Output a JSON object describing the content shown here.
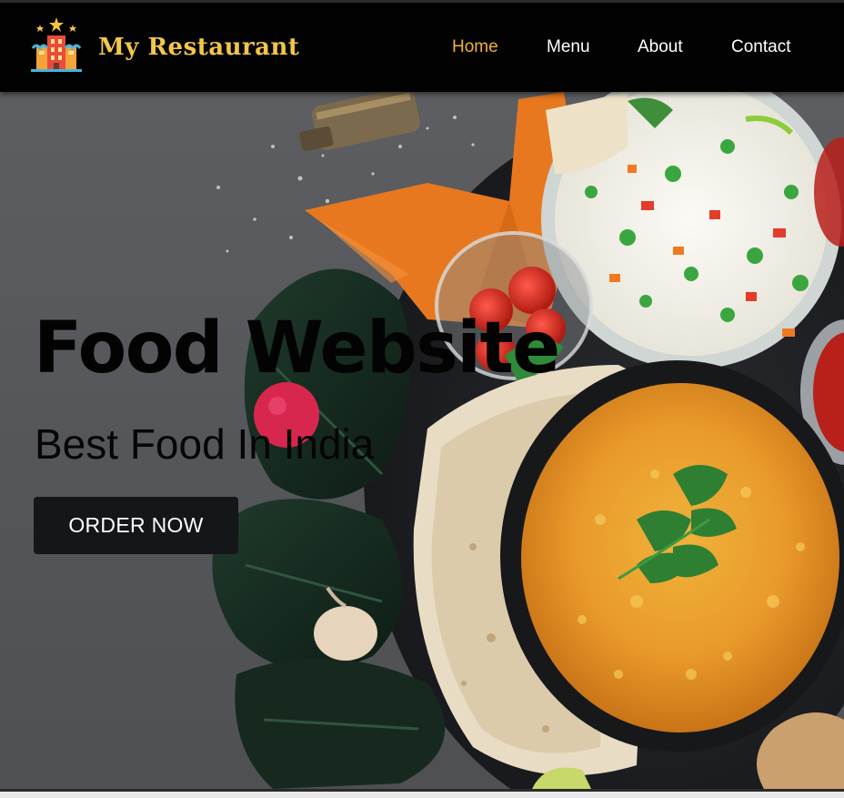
{
  "header": {
    "brand": "My Restaurant",
    "logo_icon": "restaurant-building-icon"
  },
  "nav": {
    "items": [
      {
        "label": "Home",
        "active": true
      },
      {
        "label": "Menu",
        "active": false
      },
      {
        "label": "About",
        "active": false
      },
      {
        "label": "Contact",
        "active": false
      }
    ]
  },
  "hero": {
    "title": "Food Website",
    "subtitle": "Best Food In India",
    "cta_label": "ORDER NOW",
    "background_image": "indian-food-spread-photo"
  },
  "colors": {
    "header_bg": "#020202",
    "brand": "#f1c64a",
    "nav_active": "#f2b134",
    "nav_text": "#ffffff",
    "hero_bg": "#585a5e",
    "button_bg": "#141619",
    "button_text": "#ffffff"
  }
}
